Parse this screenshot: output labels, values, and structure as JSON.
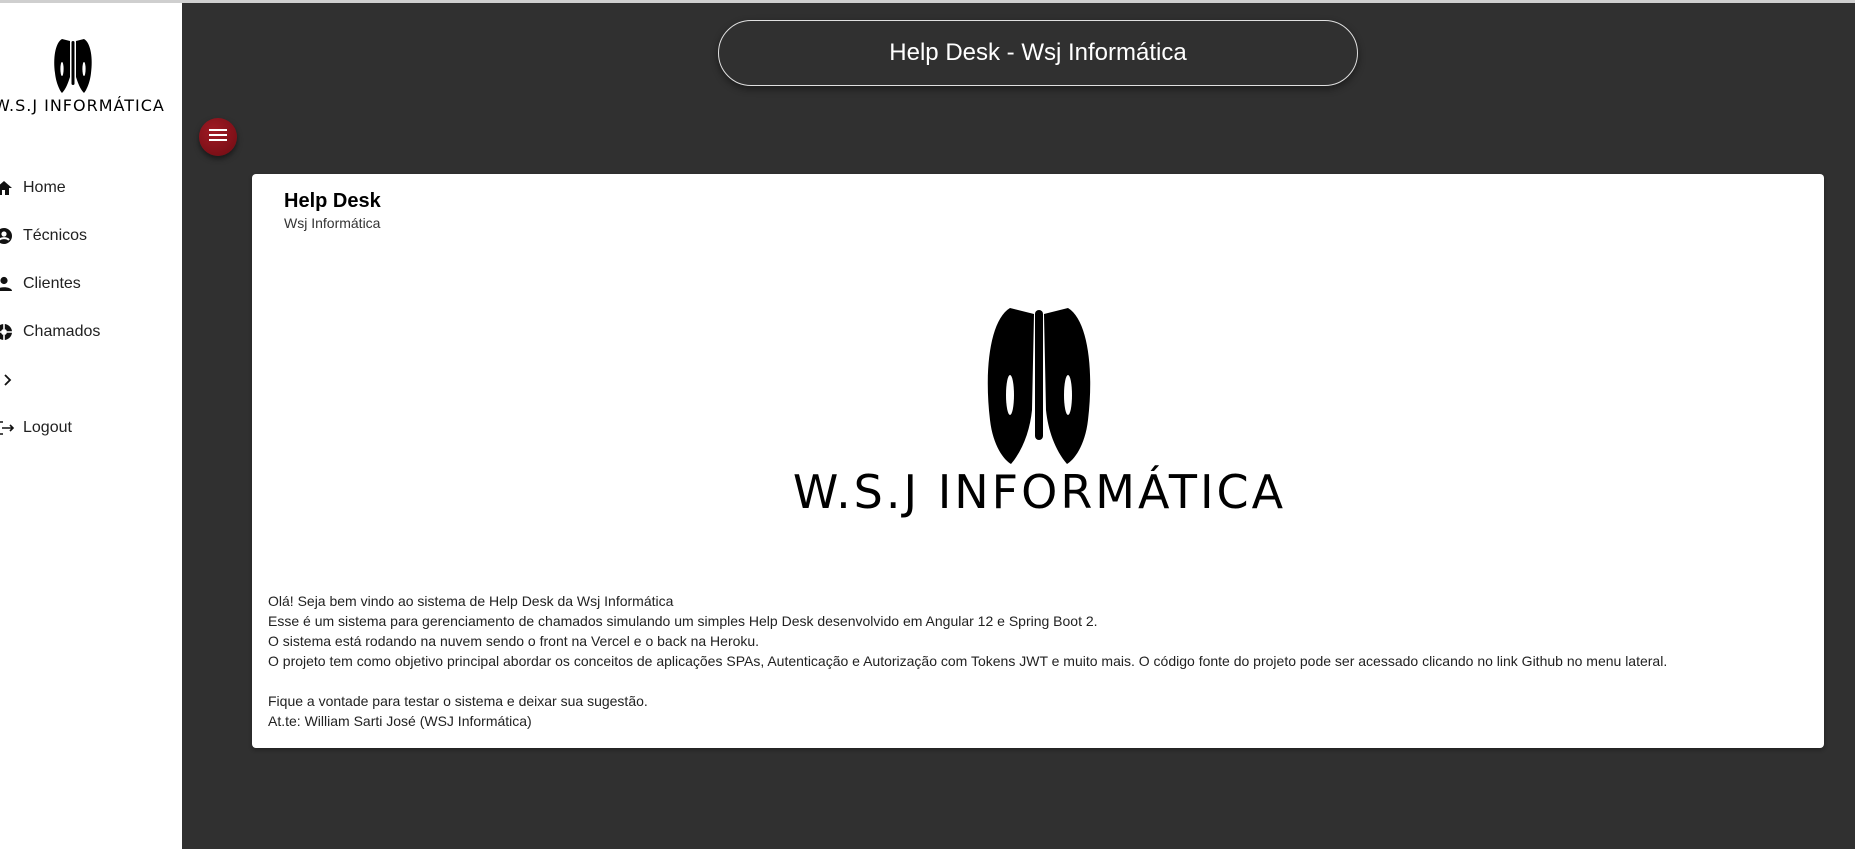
{
  "app": {
    "header_title": "Help Desk - Wsj Informática"
  },
  "sidebar": {
    "logo_text": "W.S.J INFORMÁTICA",
    "items": [
      {
        "label": "Home",
        "icon": "home-icon"
      },
      {
        "label": "Técnicos",
        "icon": "account-circle-icon"
      },
      {
        "label": "Clientes",
        "icon": "person-icon"
      },
      {
        "label": "Chamados",
        "icon": "support-icon"
      },
      {
        "label": "",
        "icon": "chevron-right-icon"
      },
      {
        "label": "Logout",
        "icon": "logout-icon"
      }
    ]
  },
  "fab": {
    "icon": "menu-icon"
  },
  "card": {
    "title": "Help Desk",
    "subtitle": "Wsj Informática",
    "logo_text": "W.S.J INFORMÁTICA",
    "paragraphs": [
      "Olá! Seja bem vindo ao sistema de Help Desk da Wsj Informática",
      "Esse é um sistema para gerenciamento de chamados simulando um simples Help Desk desenvolvido em Angular 12 e Spring Boot 2.",
      "O sistema está rodando na nuvem sendo o front na Vercel e o back na Heroku.",
      "O projeto tem como objetivo principal abordar os conceitos de aplicações SPAs, Autenticação e Autorização com Tokens JWT e muito mais. O código fonte do projeto pode ser acessado clicando no link Github no menu lateral.",
      "Fique a vontade para testar o sistema e deixar sua sugestão.",
      "At.te: William Sarti José (WSJ Informática)"
    ]
  },
  "colors": {
    "background": "#303030",
    "sidebar": "#ffffff",
    "fab": "#8b1219",
    "card": "#ffffff"
  }
}
